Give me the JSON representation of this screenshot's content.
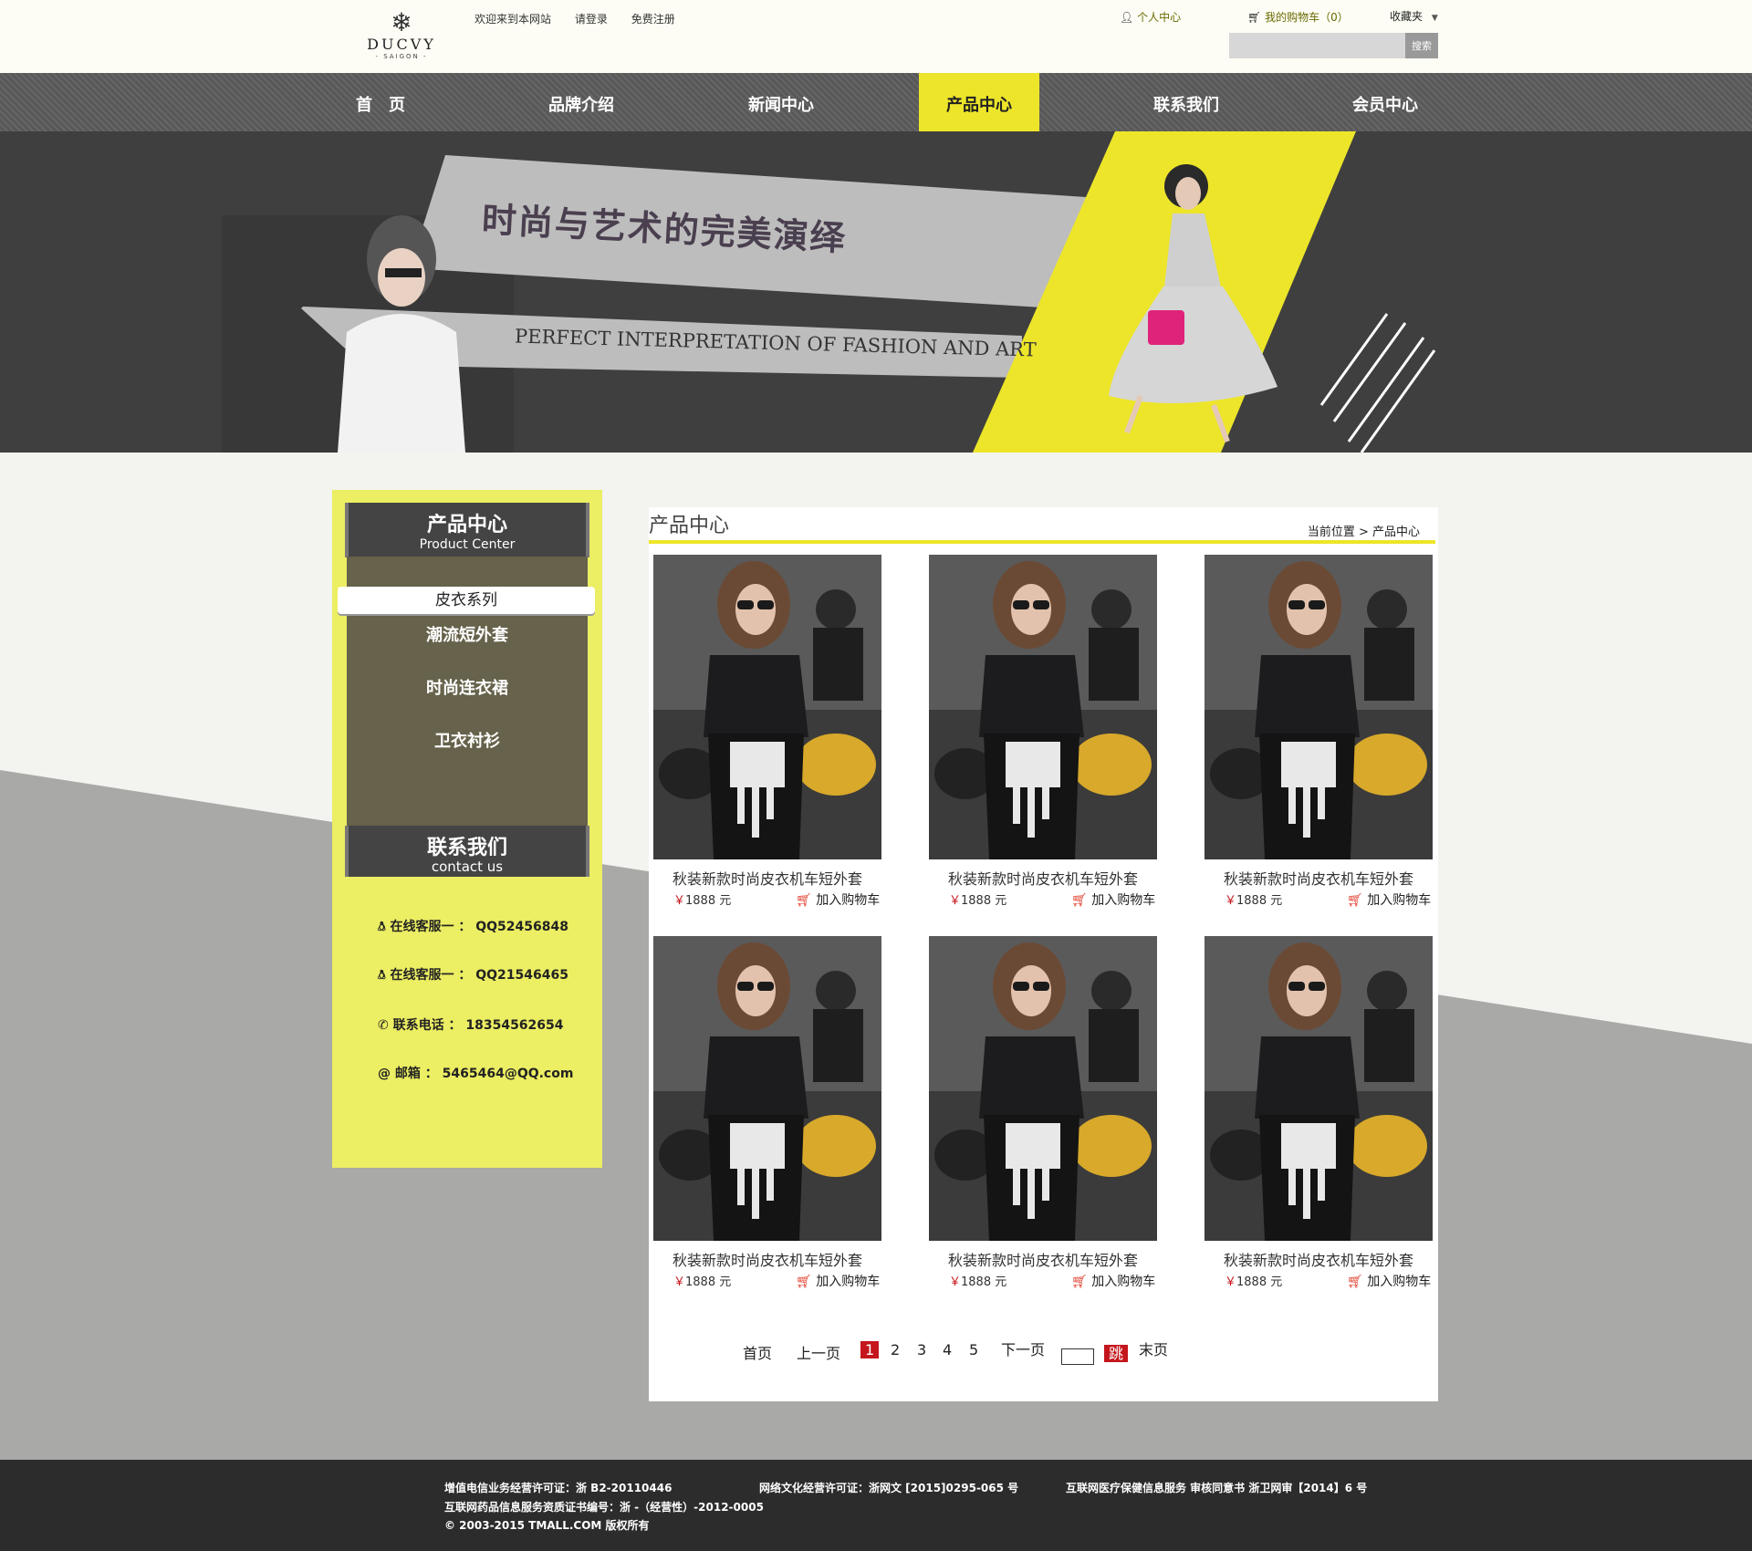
{
  "header": {
    "logo_brand": "DUCVY",
    "logo_sub": "- SAIGON -",
    "welcome": "欢迎来到本网站",
    "login": "请登录",
    "register": "免费注册",
    "user_center": "个人中心",
    "cart": "我的购物车（0）",
    "favorites": "收藏夹",
    "search_placeholder": "",
    "search_button": "搜索"
  },
  "nav": {
    "items": [
      "首　页",
      "品牌介绍",
      "新闻中心",
      "产品中心",
      "联系我们",
      "会员中心"
    ],
    "active_index": 3
  },
  "banner": {
    "title_cn": "时尚与艺术的完美演绎",
    "title_en": "PERFECT INTERPRETATION OF FASHION AND ART"
  },
  "sidebar": {
    "product_center_title": "产品中心",
    "product_center_en": "Product Center",
    "active_tab": "皮衣系列",
    "menu": [
      "潮流短外套",
      "时尚连衣裙",
      "卫衣衬衫"
    ],
    "contact_title": "联系我们",
    "contact_en": "contact us",
    "contacts": [
      {
        "icon": "qq-icon",
        "label": "在线客服一 ：",
        "value": "QQ52456848"
      },
      {
        "icon": "qq-icon",
        "label": "在线客服一 ：",
        "value": "QQ21546465"
      },
      {
        "icon": "phone-icon",
        "label": "联系电话 ：",
        "value": "18354562654"
      },
      {
        "icon": "at-icon",
        "label": "邮箱 ：",
        "value": "5465464@QQ.com"
      }
    ]
  },
  "content": {
    "title": "产品中心",
    "breadcrumb": "当前位置 > 产品中心",
    "products": [
      {
        "name": "秋装新款时尚皮衣机车短外套",
        "price": "1888 元",
        "add": "加入购物车"
      },
      {
        "name": "秋装新款时尚皮衣机车短外套",
        "price": "1888 元",
        "add": "加入购物车"
      },
      {
        "name": "秋装新款时尚皮衣机车短外套",
        "price": "1888 元",
        "add": "加入购物车"
      },
      {
        "name": "秋装新款时尚皮衣机车短外套",
        "price": "1888 元",
        "add": "加入购物车"
      },
      {
        "name": "秋装新款时尚皮衣机车短外套",
        "price": "1888 元",
        "add": "加入购物车"
      },
      {
        "name": "秋装新款时尚皮衣机车短外套",
        "price": "1888 元",
        "add": "加入购物车"
      }
    ],
    "currency": "￥",
    "pager": {
      "first": "首页",
      "prev": "上一页",
      "pages": [
        "1",
        "2",
        "3",
        "4",
        "5"
      ],
      "current": "1",
      "next": "下一页",
      "jump": "跳",
      "last": "末页"
    }
  },
  "footer": {
    "line1a": "增值电信业务经营许可证：浙 B2-20110446",
    "line1b": "网络文化经营许可证：浙网文 [2015]0295-065 号",
    "line1c": "互联网医疗保健信息服务 审核同意书 浙卫网审【2014】6 号",
    "line2": "互联网药品信息服务资质证书编号：浙 -（经营性）-2012-0005",
    "line3": "© 2003-2015 TMALL.COM 版权所有"
  },
  "colors": {
    "accent_yellow": "#ede52a",
    "nav_gray": "#5f5f5f",
    "banner_dark": "#3f3f3f",
    "sidebar_olive": "#66624b",
    "page_red": "#c4161c",
    "footer_dark": "#2c2c2c"
  }
}
